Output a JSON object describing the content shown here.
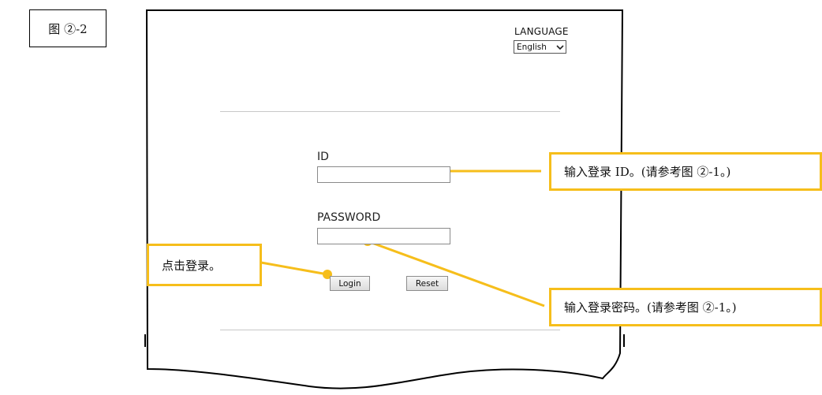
{
  "figure_label": "图 ②-2",
  "language": {
    "label": "LANGUAGE",
    "selected": "English",
    "chevron_icon": "chevron-down-icon"
  },
  "form": {
    "id_label": "ID",
    "id_value": "",
    "password_label": "PASSWORD",
    "password_value": "",
    "login_button": "Login",
    "reset_button": "Reset"
  },
  "callouts": {
    "login_id": "输入登录 ID。(请参考图 ②-1。)",
    "password": "输入登录密码。(请参考图 ②-1。)",
    "click_login": "点击登录。"
  },
  "colors": {
    "callout_accent": "#f6be1b",
    "frame": "#000000",
    "rule": "#c8c8c8"
  }
}
